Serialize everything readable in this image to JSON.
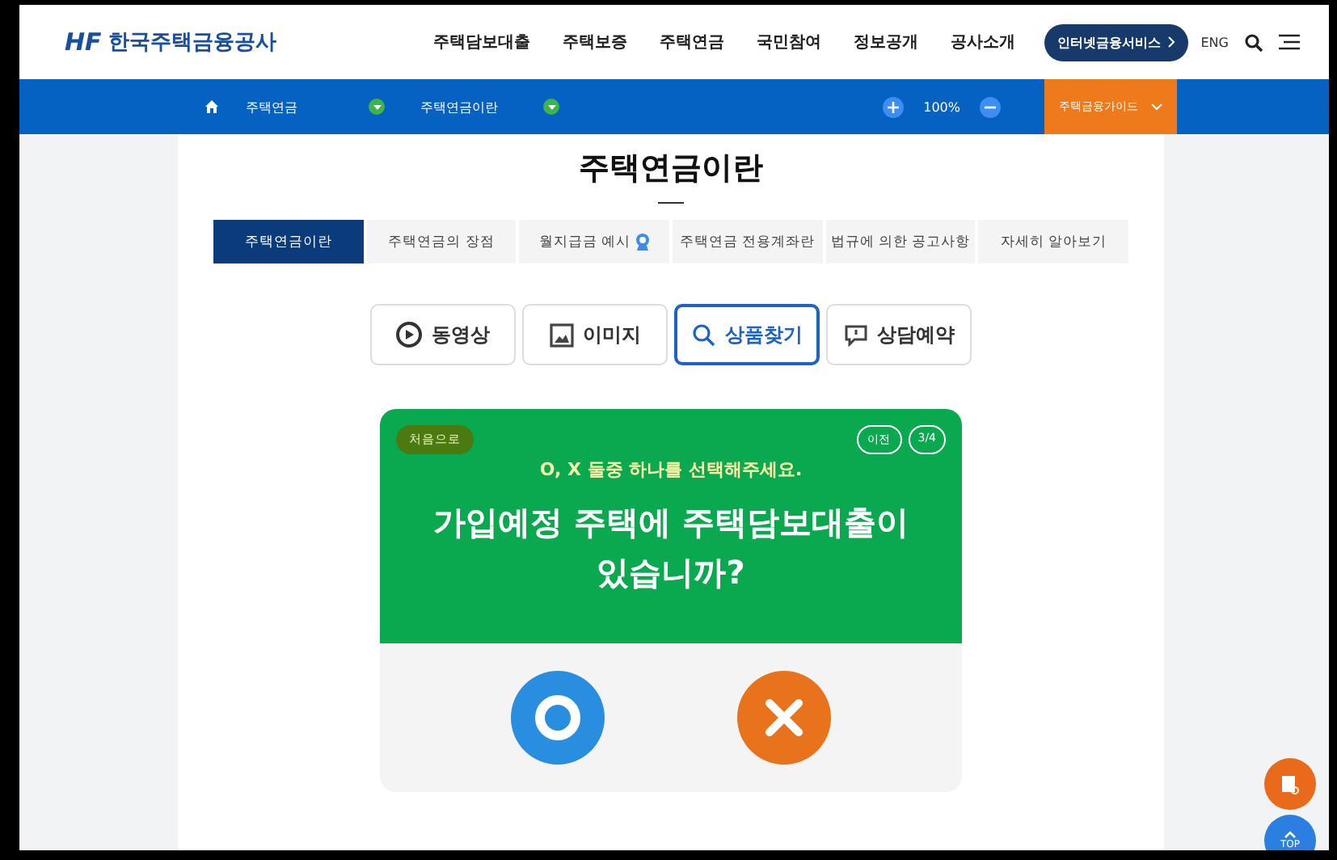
{
  "header": {
    "logo_mark": "HF",
    "logo_text": "한국주택금융공사",
    "nav": [
      "주택담보대출",
      "주택보증",
      "주택연금",
      "국민참여",
      "정보공개",
      "공사소개"
    ],
    "service_button": "인터넷금융서비스",
    "lang": "ENG"
  },
  "breadcrumb": {
    "items": [
      "주택연금",
      "주택연금이란"
    ],
    "zoom": "100%",
    "guide": "주택금융가이드"
  },
  "page_title": "주택연금이란",
  "tabs": [
    {
      "label": "주택연금이란",
      "selected": true
    },
    {
      "label": "주택연금의 장점",
      "selected": false
    },
    {
      "label": "월지급금 예시",
      "selected": false,
      "badge": true
    },
    {
      "label": "주택연금 전용계좌란",
      "selected": false
    },
    {
      "label": "법규에 의한 공고사항",
      "selected": false
    },
    {
      "label": "자세히 알아보기",
      "selected": false
    }
  ],
  "content_buttons": [
    {
      "kind": "video",
      "label": "동영상",
      "selected": false
    },
    {
      "kind": "image",
      "label": "이미지",
      "selected": false
    },
    {
      "kind": "search",
      "label": "상품찾기",
      "selected": true
    },
    {
      "kind": "consult",
      "label": "상담예약",
      "selected": false
    }
  ],
  "quiz": {
    "restart": "처음으로",
    "prev": "이전",
    "step": "3/4",
    "instruction": "O, X 둘중 하나를 선택해주세요.",
    "question": "가입예정 주택에 주택담보대출이 있습니까?",
    "answers": [
      {
        "kind": "o"
      },
      {
        "kind": "x"
      }
    ]
  },
  "top_button": "TOP"
}
